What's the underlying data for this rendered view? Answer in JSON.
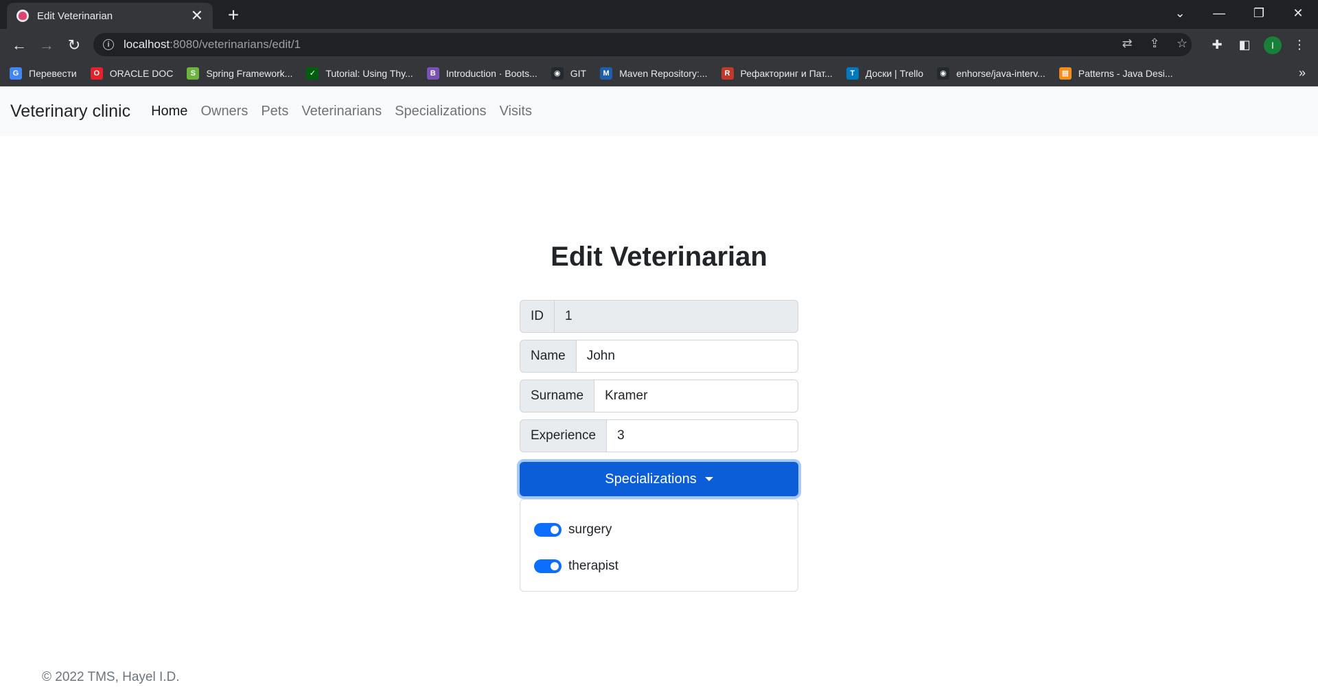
{
  "browser": {
    "tab_title": "Edit Veterinarian",
    "tab_close": "✕",
    "new_tab": "+",
    "url_host": "localhost",
    "url_path": ":8080/veterinarians/edit/1",
    "profile_initial": "I",
    "bookmarks": [
      {
        "label": "Перевести",
        "icon": "google-translate-icon",
        "color": "#4285f4",
        "glyph": "G"
      },
      {
        "label": "ORACLE DOC",
        "icon": "oracle-icon",
        "color": "#e3222c",
        "glyph": "O"
      },
      {
        "label": "Spring Framework...",
        "icon": "spring-icon",
        "color": "#6db33f",
        "glyph": "S"
      },
      {
        "label": "Tutorial: Using Thy...",
        "icon": "thymeleaf-icon",
        "color": "#005f0f",
        "glyph": "✓"
      },
      {
        "label": "Introduction · Boots...",
        "icon": "bootstrap-icon",
        "color": "#7952b3",
        "glyph": "B"
      },
      {
        "label": "GIT",
        "icon": "github-icon",
        "color": "#24292f",
        "glyph": "◉"
      },
      {
        "label": "Maven Repository:...",
        "icon": "maven-icon",
        "color": "#1d5fa8",
        "glyph": "M"
      },
      {
        "label": "Рефакторинг и Пат...",
        "icon": "refactoring-icon",
        "color": "#c0392b",
        "glyph": "R"
      },
      {
        "label": "Доски | Trello",
        "icon": "trello-icon",
        "color": "#0079bf",
        "glyph": "T"
      },
      {
        "label": "enhorse/java-interv...",
        "icon": "github-icon",
        "color": "#24292f",
        "glyph": "◉"
      },
      {
        "label": "Patterns - Java Desi...",
        "icon": "patterns-icon",
        "color": "#f28c1a",
        "glyph": "▦"
      }
    ]
  },
  "navbar": {
    "brand": "Veterinary clinic",
    "links": [
      {
        "label": "Home",
        "active": true
      },
      {
        "label": "Owners",
        "active": false
      },
      {
        "label": "Pets",
        "active": false
      },
      {
        "label": "Veterinarians",
        "active": false
      },
      {
        "label": "Specializations",
        "active": false
      },
      {
        "label": "Visits",
        "active": false
      }
    ]
  },
  "page": {
    "title": "Edit Veterinarian"
  },
  "form": {
    "id_label": "ID",
    "id_value": "1",
    "name_label": "Name",
    "name_value": "John",
    "surname_label": "Surname",
    "surname_value": "Kramer",
    "experience_label": "Experience",
    "experience_value": "3",
    "specializations_button": "Specializations",
    "specializations": [
      {
        "label": "surgery",
        "checked": true
      },
      {
        "label": "therapist",
        "checked": true
      }
    ]
  },
  "footer": {
    "text": "© 2022 TMS, Hayel I.D."
  },
  "colors": {
    "primary": "#0d6efd",
    "button_active": "#0b5ed7",
    "navbar_bg": "#f8f9fa"
  }
}
